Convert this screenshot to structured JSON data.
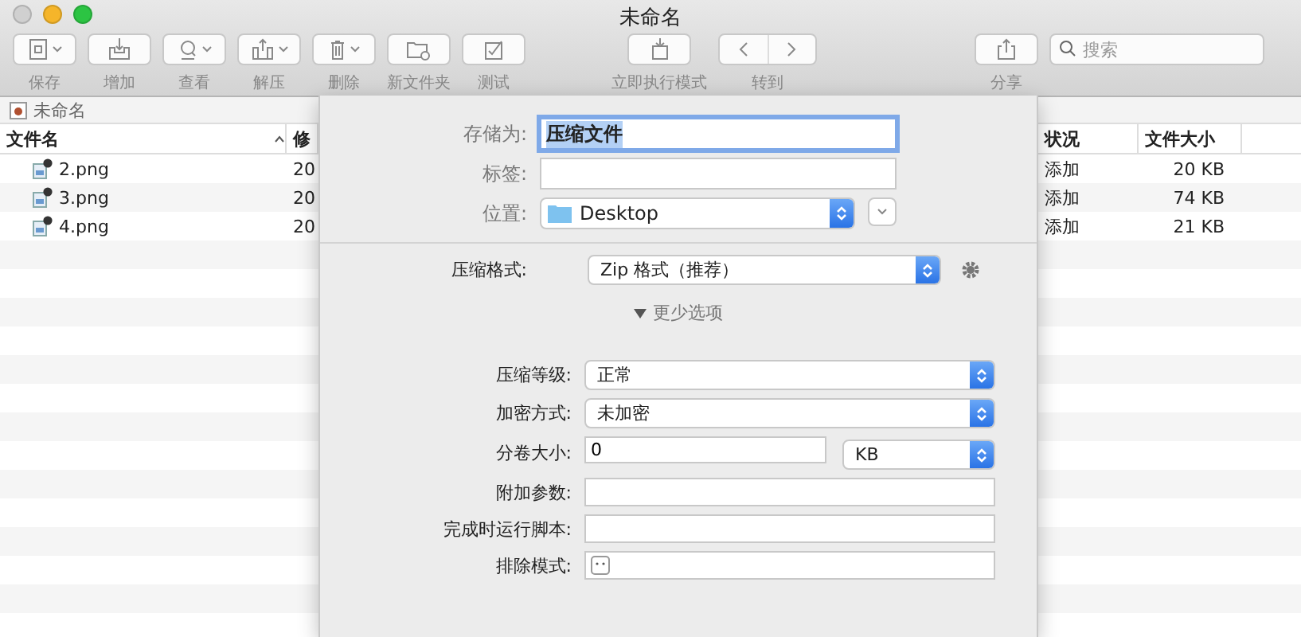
{
  "window": {
    "title": "未命名"
  },
  "toolbar": {
    "items": [
      {
        "label": "保存",
        "has_menu": true
      },
      {
        "label": "增加",
        "has_menu": false
      },
      {
        "label": "查看",
        "has_menu": true
      },
      {
        "label": "解压",
        "has_menu": true
      },
      {
        "label": "删除",
        "has_menu": true
      },
      {
        "label": "新文件夹",
        "has_menu": false
      },
      {
        "label": "测试",
        "has_menu": false
      }
    ],
    "run_mode": {
      "label": "立即执行模式"
    },
    "goto": {
      "label": "转到"
    },
    "share": {
      "label": "分享"
    },
    "search": {
      "placeholder": "搜索"
    }
  },
  "path_bar": {
    "label": "未命名"
  },
  "table": {
    "columns": [
      "文件名",
      "修",
      "状况",
      "文件大小"
    ],
    "rows": [
      {
        "name": "2.png",
        "date": "20",
        "status": "添加",
        "size": "20 KB"
      },
      {
        "name": "3.png",
        "date": "20",
        "status": "添加",
        "size": "74 KB"
      },
      {
        "name": "4.png",
        "date": "20",
        "status": "添加",
        "size": "21 KB"
      }
    ]
  },
  "sheet": {
    "save_as": {
      "label": "存储为:",
      "value": "压缩文件"
    },
    "tags": {
      "label": "标签:"
    },
    "location": {
      "label": "位置:",
      "value": "Desktop"
    },
    "format": {
      "label": "压缩格式:",
      "value": "Zip 格式（推荐）"
    },
    "disclosure": {
      "label": "更少选项",
      "expanded": true
    },
    "options": [
      {
        "kind": "select",
        "label": "压缩等级:",
        "value": "正常"
      },
      {
        "kind": "select",
        "label": "加密方式:",
        "value": "未加密"
      },
      {
        "kind": "field_unit",
        "label": "分卷大小:",
        "value": "0",
        "unit": "KB"
      },
      {
        "kind": "field",
        "label": "附加参数:"
      },
      {
        "kind": "field",
        "label": "完成时运行脚本:"
      },
      {
        "kind": "token_field",
        "label": "排除模式:"
      }
    ]
  }
}
